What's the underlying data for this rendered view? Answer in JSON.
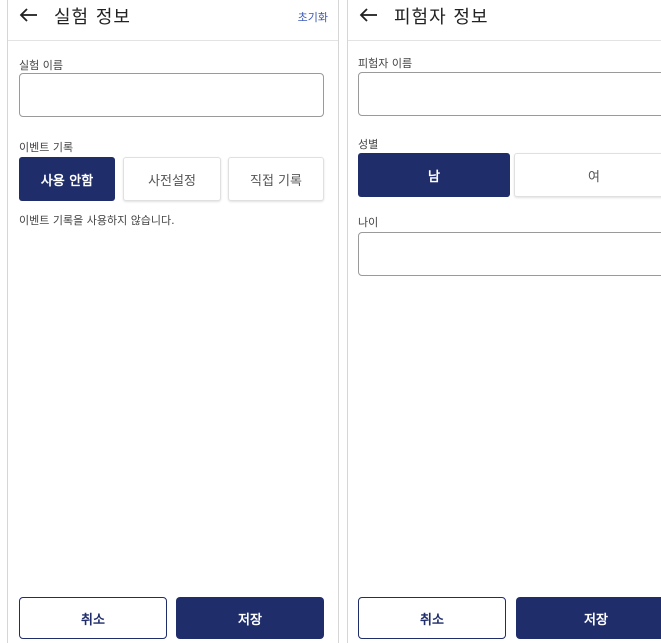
{
  "left_screen": {
    "title": "실험 정보",
    "reset_label": "초기화",
    "name_field": {
      "label": "실험 이름",
      "value": "",
      "placeholder": ""
    },
    "event_logging": {
      "label": "이벤트 기록",
      "options": [
        "사용 안함",
        "사전설정",
        "직접 기록"
      ],
      "selected": "사용 안함",
      "helper_text": "이벤트 기록을 사용하지 않습니다."
    },
    "cancel_label": "취소",
    "save_label": "저장"
  },
  "right_screen": {
    "title": "피험자 정보",
    "name_field": {
      "label": "피험자 이름",
      "value": "",
      "placeholder": ""
    },
    "gender": {
      "label": "성별",
      "options": [
        "남",
        "여"
      ],
      "selected": "남"
    },
    "age_field": {
      "label": "나이",
      "value": "",
      "placeholder": ""
    },
    "cancel_label": "취소",
    "save_label": "저장"
  },
  "colors": {
    "primary": "#1f2d6b",
    "link": "#3c59b8",
    "border": "#9a9a9a"
  }
}
